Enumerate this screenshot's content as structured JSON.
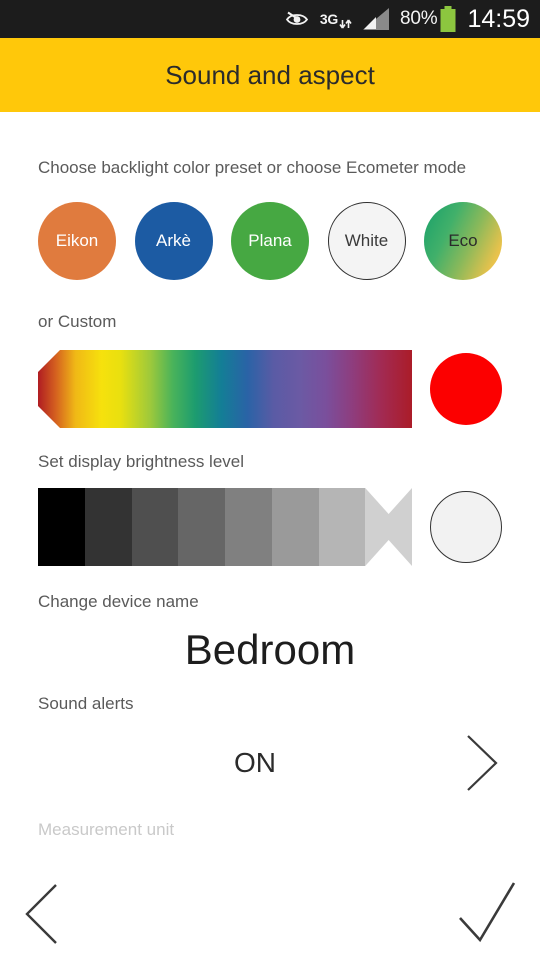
{
  "statusbar": {
    "eye_icon": "eye-blocked-icon",
    "network_label": "3G",
    "network_arrows_icon": "data-transfer-arrows-icon",
    "signal_icon": "signal-bars-icon",
    "battery_percent": "80%",
    "battery_icon": "battery-icon",
    "clock": "14:59"
  },
  "appbar": {
    "title": "Sound and aspect"
  },
  "backlight": {
    "label": "Choose backlight color preset or choose Ecometer mode",
    "presets": [
      {
        "label": "Eikon",
        "color": "#e07b3e"
      },
      {
        "label": "Arkè",
        "color": "#1c5ba3"
      },
      {
        "label": "Plana",
        "color": "#46a842"
      },
      {
        "label": "White",
        "color": "#f4f4f4"
      },
      {
        "label": "Eco",
        "color": "#41b06a"
      }
    ]
  },
  "custom": {
    "label": "or Custom",
    "selected_color": "#fc0000"
  },
  "brightness": {
    "label": "Set display brightness level",
    "steps": [
      "#000000",
      "#333333",
      "#4f4f4f",
      "#666666",
      "#808080",
      "#9a9a9a",
      "#b5b5b5",
      "#d0d0d0"
    ],
    "selected_index": 7,
    "preview_color": "#f2f2f2"
  },
  "device": {
    "label": "Change device name",
    "name": "Bedroom"
  },
  "alerts": {
    "label": "Sound alerts",
    "value": "ON",
    "chevron_icon": "chevron-right-icon"
  },
  "measurement": {
    "label": "Measurement unit"
  },
  "bottom": {
    "back_icon": "chevron-left-icon",
    "confirm_icon": "checkmark-icon"
  }
}
